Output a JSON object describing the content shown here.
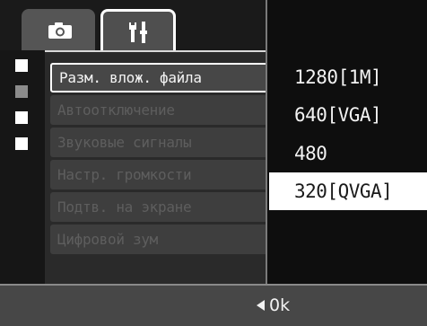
{
  "tabs": [
    {
      "name": "camera",
      "icon": "camera-icon",
      "active": false
    },
    {
      "name": "setup",
      "icon": "setup-icon",
      "active": true
    }
  ],
  "page_indicator": {
    "total": 4,
    "current": 2,
    "icon": "page-square-icon"
  },
  "menu": {
    "items": [
      {
        "label": "Разм. влож. файла"
      },
      {
        "label": "Автоотключение"
      },
      {
        "label": "Звуковые сигналы"
      },
      {
        "label": "Настр. громкости"
      },
      {
        "label": "Подтв. на экране"
      },
      {
        "label": "Цифровой зум"
      }
    ],
    "selected_index": 0
  },
  "options": {
    "items": [
      {
        "label": "1280[1M]"
      },
      {
        "label": "640[VGA]"
      },
      {
        "label": "480"
      },
      {
        "label": "320[QVGA]"
      }
    ],
    "selected_index": 3
  },
  "footer": {
    "ok_label": "0k",
    "arrow_icon": "left-arrow-icon"
  },
  "colors": {
    "highlight": "#ffffff",
    "background": "#141414",
    "panel": "#2a2a2a"
  }
}
